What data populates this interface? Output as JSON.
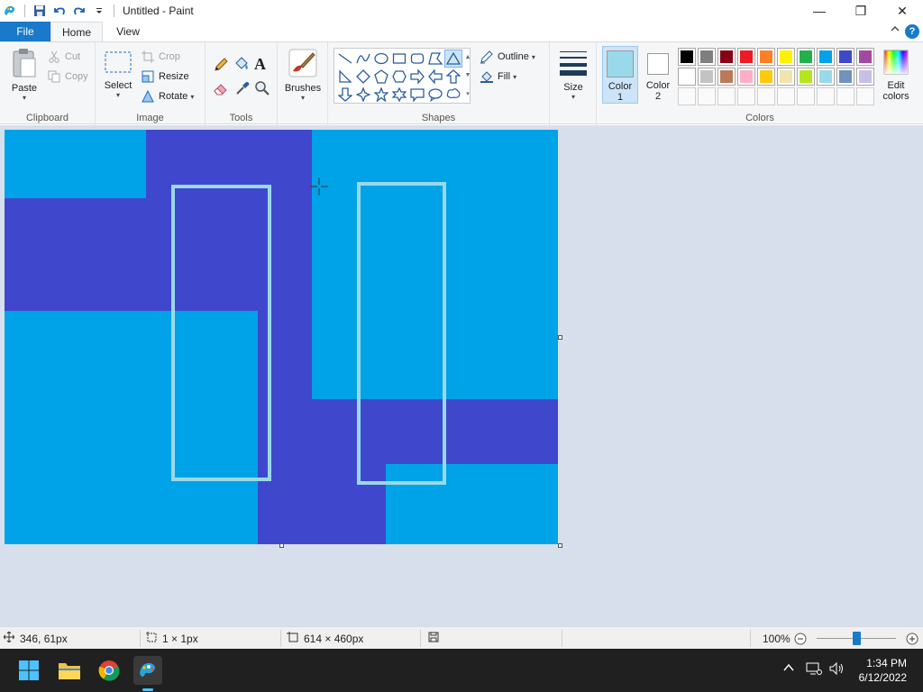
{
  "window": {
    "title": "Untitled - Paint",
    "minimize_glyph": "—",
    "maximize_glyph": "❐",
    "close_glyph": "✕"
  },
  "tabs": {
    "file": "File",
    "home": "Home",
    "view": "View"
  },
  "clipboard": {
    "paste": "Paste",
    "cut": "Cut",
    "copy": "Copy",
    "group": "Clipboard"
  },
  "image": {
    "select": "Select",
    "crop": "Crop",
    "resize": "Resize",
    "rotate": "Rotate",
    "group": "Image"
  },
  "tools": {
    "group": "Tools",
    "text_glyph": "A"
  },
  "brushes": {
    "label": "Brushes"
  },
  "shapes": {
    "outline": "Outline",
    "fill": "Fill",
    "group": "Shapes"
  },
  "size": {
    "label": "Size"
  },
  "colors": {
    "color1_label": "Color",
    "color1_num": "1",
    "color2_label": "Color",
    "color2_num": "2",
    "edit_label_1": "Edit",
    "edit_label_2": "colors",
    "group": "Colors",
    "color1_value": "#99d9ea",
    "color2_value": "#ffffff",
    "palette_row1": [
      "#000000",
      "#7f7f7f",
      "#880015",
      "#ed1c24",
      "#ff7f27",
      "#fff200",
      "#22b14c",
      "#00a2e8",
      "#3f48cc",
      "#a349a4"
    ],
    "palette_row2": [
      "#ffffff",
      "#c3c3c3",
      "#b97a57",
      "#ffaec9",
      "#ffc90e",
      "#efe4b0",
      "#b5e61d",
      "#99d9ea",
      "#7092be",
      "#c8bfe7"
    ]
  },
  "canvas_colors": {
    "background": "#00a2e8",
    "dark": "#3f48cc",
    "outline": "#99d9ea"
  },
  "status": {
    "cursor_pos": "346, 61px",
    "selection_size": "1 × 1px",
    "image_size": "614 × 460px",
    "zoom": "100%"
  },
  "taskbar": {
    "time": "1:34 PM",
    "date": "6/12/2022"
  }
}
